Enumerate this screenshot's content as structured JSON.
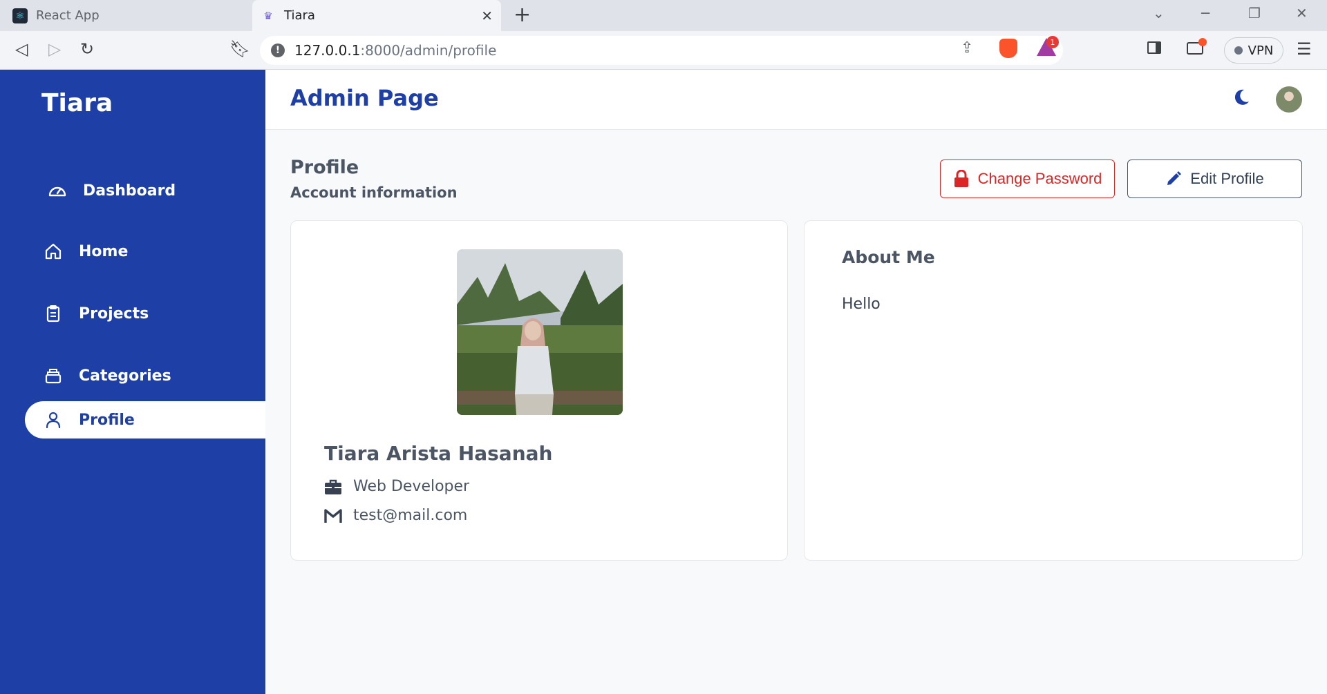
{
  "browser": {
    "tabs": [
      {
        "title": "React App",
        "active": false
      },
      {
        "title": "Tiara",
        "active": true
      }
    ],
    "url_host": "127.0.0.1",
    "url_rest": ":8000/admin/profile",
    "vpn_label": "VPN",
    "rewards_badge": "1"
  },
  "sidebar": {
    "brand": "Tiara",
    "items": [
      {
        "label": "Dashboard",
        "icon": "dashboard-gauge-icon",
        "active": false
      },
      {
        "label": "Home",
        "icon": "home-icon",
        "active": false
      },
      {
        "label": "Projects",
        "icon": "clipboard-icon",
        "active": false
      },
      {
        "label": "Categories",
        "icon": "layers-icon",
        "active": false
      },
      {
        "label": "Profile",
        "icon": "user-icon",
        "active": true
      }
    ]
  },
  "header": {
    "title": "Admin Page"
  },
  "profile": {
    "title": "Profile",
    "subtitle": "Account information",
    "change_password_label": "Change Password",
    "edit_profile_label": "Edit Profile",
    "name": "Tiara Arista Hasanah",
    "job": "Web Developer",
    "email": "test@mail.com"
  },
  "about": {
    "title": "About Me",
    "text": "Hello"
  },
  "colors": {
    "sidebar_bg": "#1e40a6",
    "accent": "#1e40a6",
    "danger": "#dc2626",
    "page_bg": "#f8f9fb"
  }
}
